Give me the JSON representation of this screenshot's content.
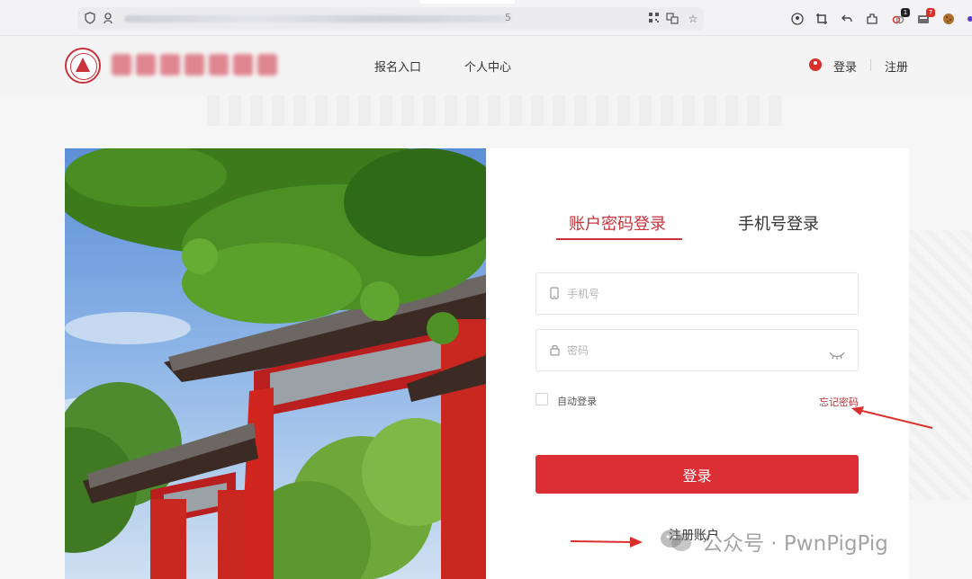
{
  "browser": {
    "url_tail": "5",
    "toolbar_badges": {
      "extension_a": "1",
      "extension_b": "7"
    }
  },
  "site": {
    "nav": {
      "apply": "报名入口",
      "personal_center": "个人中心"
    },
    "auth": {
      "login": "登录",
      "register": "注册"
    }
  },
  "login_card": {
    "tabs": [
      {
        "label": "账户密码登录",
        "active": true
      },
      {
        "label": "手机号登录",
        "active": false
      }
    ],
    "phone_placeholder": "手机号",
    "password_placeholder": "密码",
    "auto_login": "自动登录",
    "forgot_password": "忘记密码",
    "submit": "登录",
    "register_account": "注册账户"
  },
  "watermark": {
    "text": "公众号 · PwnPigPig"
  },
  "colors": {
    "brand_red": "#dc2f35",
    "link_red": "#b3363d",
    "annotation_red": "#d9302c"
  }
}
